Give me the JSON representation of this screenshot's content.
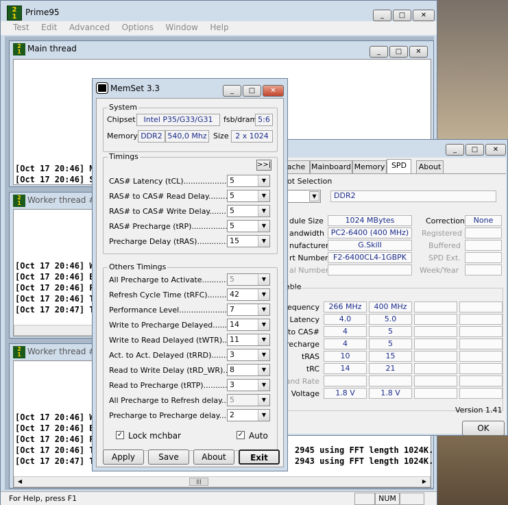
{
  "prime95": {
    "title": "Prime95",
    "menu": [
      "Test",
      "Edit",
      "Advanced",
      "Options",
      "Window",
      "Help"
    ],
    "status": "For Help, press F1",
    "num": "NUM"
  },
  "threads": {
    "main": {
      "title": "Main thread",
      "lines": [
        "[Oct 17 20:46] Mer",
        "[Oct 17 20:46] Sta"
      ]
    },
    "worker1": {
      "title": "Worker thread #1",
      "lines": [
        "[Oct 17 20:46] Wo",
        "[Oct 17 20:46] Beg",
        "[Oct 17 20:46] Ple",
        "[Oct 17 20:46] Tes",
        "[Oct 17 20:47] Tes"
      ]
    },
    "worker2": {
      "title": "Worker thread #2",
      "lines": [
        "[Oct 17 20:46] Wo",
        "[Oct 17 20:46] Beg",
        "[Oct 17 20:46] Ple",
        "[Oct 17 20:46] Tes",
        "[Oct 17 20:47] Tes"
      ],
      "tail": [
        "2945 using FFT length 1024K.",
        "2943 using FFT length 1024K."
      ]
    }
  },
  "memset": {
    "title": "MemSet 3.3",
    "system": {
      "title": "System",
      "chipset_label": "Chipset",
      "chipset": "Intel P35/G33/G31",
      "fsb_label": "fsb/dram",
      "fsb": "5:6",
      "memory_label": "Memory",
      "mem_type": "DDR2",
      "mem_speed": "540,0 Mhz",
      "size_label": "Size",
      "size": "2 x 1024"
    },
    "timings": {
      "title": "Timings",
      "expand": ">>|",
      "rows": [
        {
          "label": "CAS# Latency (tCL)............................",
          "value": "5"
        },
        {
          "label": "RAS# to CAS# Read Delay............",
          "value": "5"
        },
        {
          "label": "RAS# to CAS# Write Delay............",
          "value": "5"
        },
        {
          "label": "RAS# Precharge (tRP)....................",
          "value": "5"
        },
        {
          "label": "Precharge Delay  (tRAS)................",
          "value": "15"
        }
      ]
    },
    "others": {
      "title": "Others Timings",
      "rows": [
        {
          "label": "All Precharge to Activate...................",
          "value": "5",
          "disabled": true
        },
        {
          "label": "Refresh Cycle Time (tRFC)...............",
          "value": "42",
          "disabled": false
        },
        {
          "label": "Performance Level.............................",
          "value": "7",
          "disabled": false
        },
        {
          "label": "Write to Precharge Delayed...............",
          "value": "14",
          "disabled": false
        },
        {
          "label": "Write to Read Delayed (tWTR)............",
          "value": "11",
          "disabled": false
        },
        {
          "label": "Act. to Act. Delayed (tRRD)...............",
          "value": "3",
          "disabled": false
        },
        {
          "label": "Read to Write Delay (tRD_WR).........",
          "value": "8",
          "disabled": false
        },
        {
          "label": "Read to Precharge (tRTP)..................",
          "value": "3",
          "disabled": false
        },
        {
          "label": "All Precharge to Refresh delay...........",
          "value": "5",
          "disabled": true
        },
        {
          "label": "Precharge to Precharge delay............",
          "value": "2",
          "disabled": false
        }
      ]
    },
    "lock_label": "Lock mchbar",
    "auto_label": "Auto",
    "buttons": {
      "apply": "Apply",
      "save": "Save",
      "about": "About",
      "exit": "Exit"
    }
  },
  "spd": {
    "tabs": [
      "ache",
      "Mainboard",
      "Memory",
      "SPD",
      "About"
    ],
    "slot_selection": "lot Selection",
    "mem_type": "DDR2",
    "labels": {
      "module_size": "dule Size",
      "bandwidth": "andwidth",
      "manufacturer": "nufacturer",
      "part_number": "rt Number",
      "serial": "al Number",
      "correction": "Correction",
      "registered": "Registered",
      "buffered": "Buffered",
      "spd_ext": "SPD Ext.",
      "week_year": "Week/Year"
    },
    "module_size": "1024 MBytes",
    "correction": "None",
    "bandwidth": "PC2-6400 (400 MHz)",
    "manufacturer": "G.Skill",
    "part_number": "F2-6400CL4-1GBPK",
    "timings_table": "able",
    "table_rows": [
      {
        "label": "equency",
        "values": [
          "266 MHz",
          "400 MHz",
          "",
          ""
        ],
        "grey": false
      },
      {
        "label": "Latency",
        "values": [
          "4.0",
          "5.0",
          "",
          ""
        ],
        "grey": false
      },
      {
        "label": "to CAS#",
        "values": [
          "4",
          "5",
          "",
          ""
        ],
        "grey": false
      },
      {
        "label": "recharge",
        "values": [
          "4",
          "5",
          "",
          ""
        ],
        "grey": false
      },
      {
        "label": "tRAS",
        "values": [
          "10",
          "15",
          "",
          ""
        ],
        "grey": false
      },
      {
        "label": "tRC",
        "values": [
          "14",
          "21",
          "",
          ""
        ],
        "grey": false
      },
      {
        "label": "and Rate",
        "values": [
          "",
          "",
          "",
          ""
        ],
        "grey": true
      },
      {
        "label": "Voltage",
        "values": [
          "1.8 V",
          "1.8 V",
          "",
          ""
        ],
        "grey": false
      }
    ],
    "version": "Version 1.41",
    "ok": "OK"
  }
}
